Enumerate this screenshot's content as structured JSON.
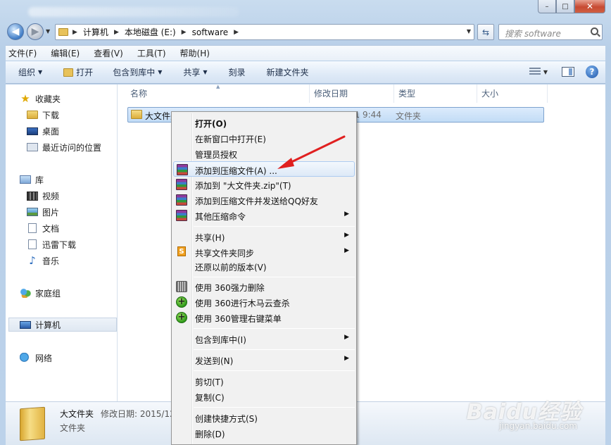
{
  "window": {
    "caption_buttons": {
      "minimize": "–",
      "maximize": "□",
      "close": "✕"
    }
  },
  "address": {
    "crumbs": [
      "计算机",
      "本地磁盘 (E:)",
      "software"
    ],
    "search_placeholder": "搜索 software"
  },
  "menubar": [
    "文件(F)",
    "编辑(E)",
    "查看(V)",
    "工具(T)",
    "帮助(H)"
  ],
  "toolbar": {
    "organize": "组织",
    "open": "打开",
    "include_library": "包含到库中",
    "share": "共享",
    "burn": "刻录",
    "new_folder": "新建文件夹"
  },
  "sidebar": {
    "favorites": "收藏夹",
    "downloads": "下载",
    "desktop": "桌面",
    "recent": "最近访问的位置",
    "libraries": "库",
    "videos": "视频",
    "pictures": "图片",
    "documents": "文档",
    "xunlei": "迅雷下载",
    "music": "音乐",
    "homegroup": "家庭组",
    "computer": "计算机",
    "network": "网络"
  },
  "columns": {
    "name": "名称",
    "date": "修改日期",
    "type": "类型",
    "size": "大小"
  },
  "file": {
    "name": "大文件夹",
    "date": "2015/12/21 9:44",
    "type": "文件夹"
  },
  "details": {
    "name": "大文件夹",
    "meta": "修改日期: 2015/12",
    "type": "文件夹"
  },
  "context_menu": {
    "open": "打开(O)",
    "open_new_window": "在新窗口中打开(E)",
    "admin_grant": "管理员授权",
    "add_archive": "添加到压缩文件(A) ...",
    "add_zip": "添加到 \"大文件夹.zip\"(T)",
    "add_send_qq": "添加到压缩文件并发送给QQ好友",
    "other_compress": "其他压缩命令",
    "share": "共享(H)",
    "share_sync": "共享文件夹同步",
    "restore": "还原以前的版本(V)",
    "s360_delete": "使用 360强力删除",
    "s360_scan": "使用 360进行木马云查杀",
    "s360_menu": "使用 360管理右键菜单",
    "include_library": "包含到库中(I)",
    "send_to": "发送到(N)",
    "cut": "剪切(T)",
    "copy": "复制(C)",
    "shortcut": "创建快捷方式(S)",
    "delete": "删除(D)"
  },
  "watermark": {
    "brand": "Baidu经验",
    "url": "jingyan.baidu.com"
  },
  "colors": {
    "annotation_arrow": "#e02020",
    "selection": "#c2dcf6"
  }
}
